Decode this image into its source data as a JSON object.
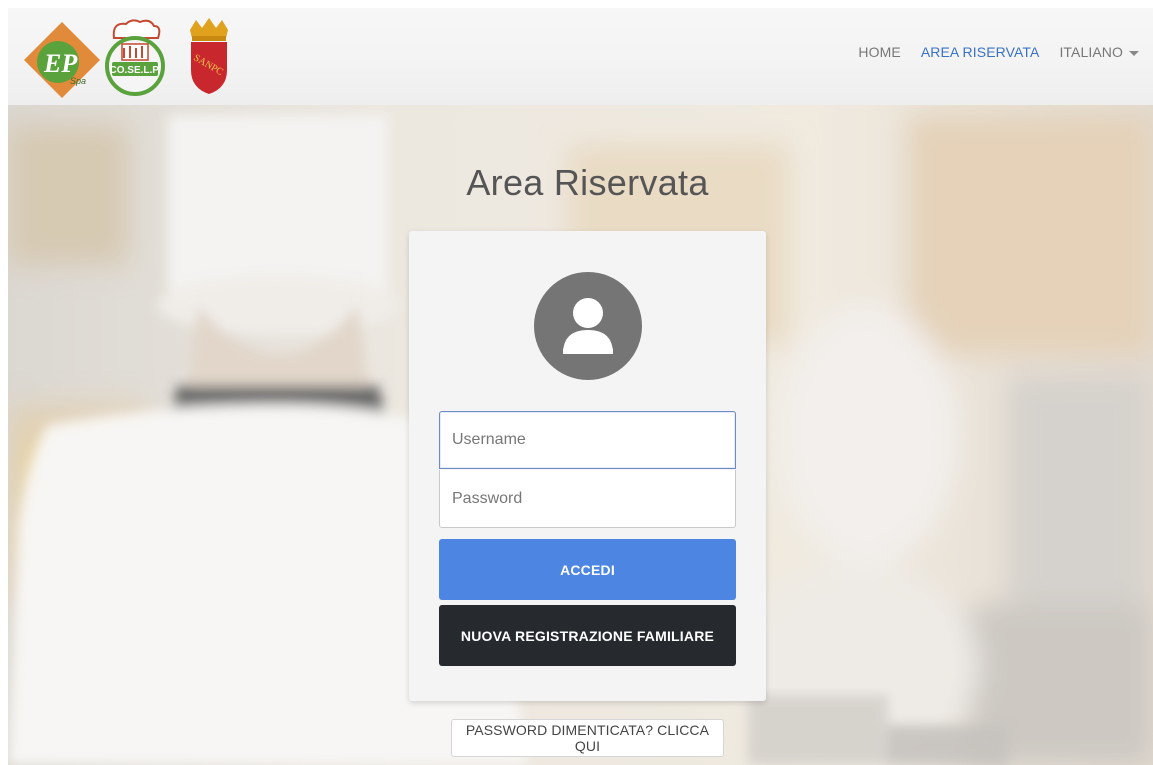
{
  "header": {
    "logos": [
      {
        "name": "ep-spa-logo",
        "text": "EP",
        "subtext": "Spa"
      },
      {
        "name": "coselp-logo",
        "text": "CO.SE.L.P."
      },
      {
        "name": "sanpc-crest",
        "text": "SANPC"
      }
    ],
    "nav": {
      "home": "HOME",
      "area_riservata": "AREA RISERVATA",
      "language": "ITALIANO"
    }
  },
  "main": {
    "title": "Area Riservata",
    "login": {
      "username_placeholder": "Username",
      "password_placeholder": "Password",
      "login_button": "ACCEDI",
      "register_button": "NUOVA REGISTRAZIONE FAMILIARE"
    },
    "forgot_password": "PASSWORD DIMENTICATA? CLICCA QUI"
  },
  "colors": {
    "accent": "#4d86e2",
    "active_nav": "#3a73c4",
    "dark_button": "#262a2e",
    "avatar": "#757575"
  }
}
